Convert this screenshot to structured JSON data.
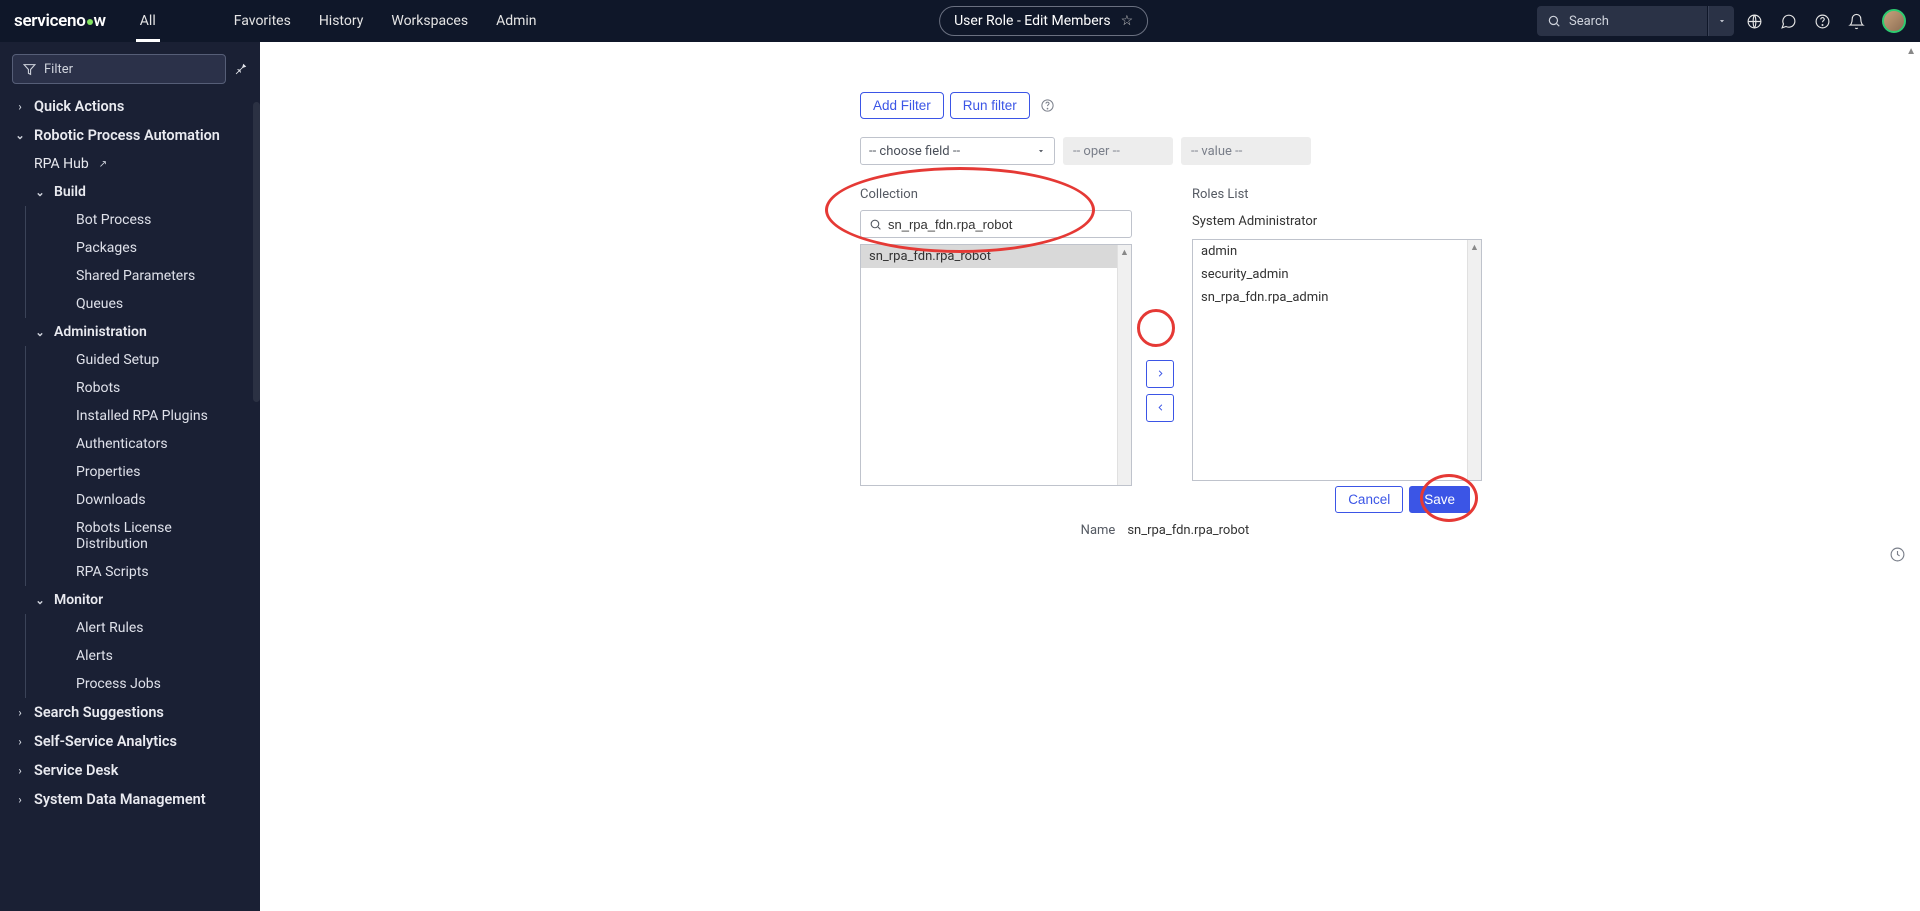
{
  "header": {
    "logo_text_a": "serviceno",
    "logo_text_b": "w",
    "nav_all": "All",
    "nav_favorites": "Favorites",
    "nav_history": "History",
    "nav_workspaces": "Workspaces",
    "nav_admin": "Admin",
    "pill_label": "User Role - Edit Members",
    "search_placeholder": "Search"
  },
  "side": {
    "filter_placeholder": "Filter",
    "quick_actions": "Quick Actions",
    "rpa_root": "Robotic Process Automation",
    "rpa_hub": "RPA Hub",
    "build": "Build",
    "build_items": {
      "bot_process": "Bot Process",
      "packages": "Packages",
      "shared_params": "Shared Parameters",
      "queues": "Queues"
    },
    "administration": "Administration",
    "admin_items": {
      "guided_setup": "Guided Setup",
      "robots": "Robots",
      "installed_plugins": "Installed RPA Plugins",
      "authenticators": "Authenticators",
      "properties": "Properties",
      "downloads": "Downloads",
      "license_dist": "Robots License Distribution",
      "rpa_scripts": "RPA Scripts"
    },
    "monitor": "Monitor",
    "monitor_items": {
      "alert_rules": "Alert Rules",
      "alerts": "Alerts",
      "process_jobs": "Process Jobs"
    },
    "search_suggestions": "Search Suggestions",
    "self_service_analytics": "Self-Service Analytics",
    "service_desk": "Service Desk",
    "system_data_mgmt": "System Data Management"
  },
  "form": {
    "add_filter": "Add Filter",
    "run_filter": "Run filter",
    "choose_field": "-- choose field --",
    "oper": "-- oper --",
    "value": "-- value --",
    "collection_label": "Collection",
    "collection_search": "sn_rpa_fdn.rpa_robot",
    "collection_items": [
      "sn_rpa_fdn.rpa_robot"
    ],
    "roles_label": "Roles List",
    "roles_subtitle": "System Administrator",
    "roles_items": [
      "admin",
      "security_admin",
      "sn_rpa_fdn.rpa_admin"
    ],
    "cancel": "Cancel",
    "save": "Save",
    "name_label": "Name",
    "name_value": "sn_rpa_fdn.rpa_robot"
  }
}
